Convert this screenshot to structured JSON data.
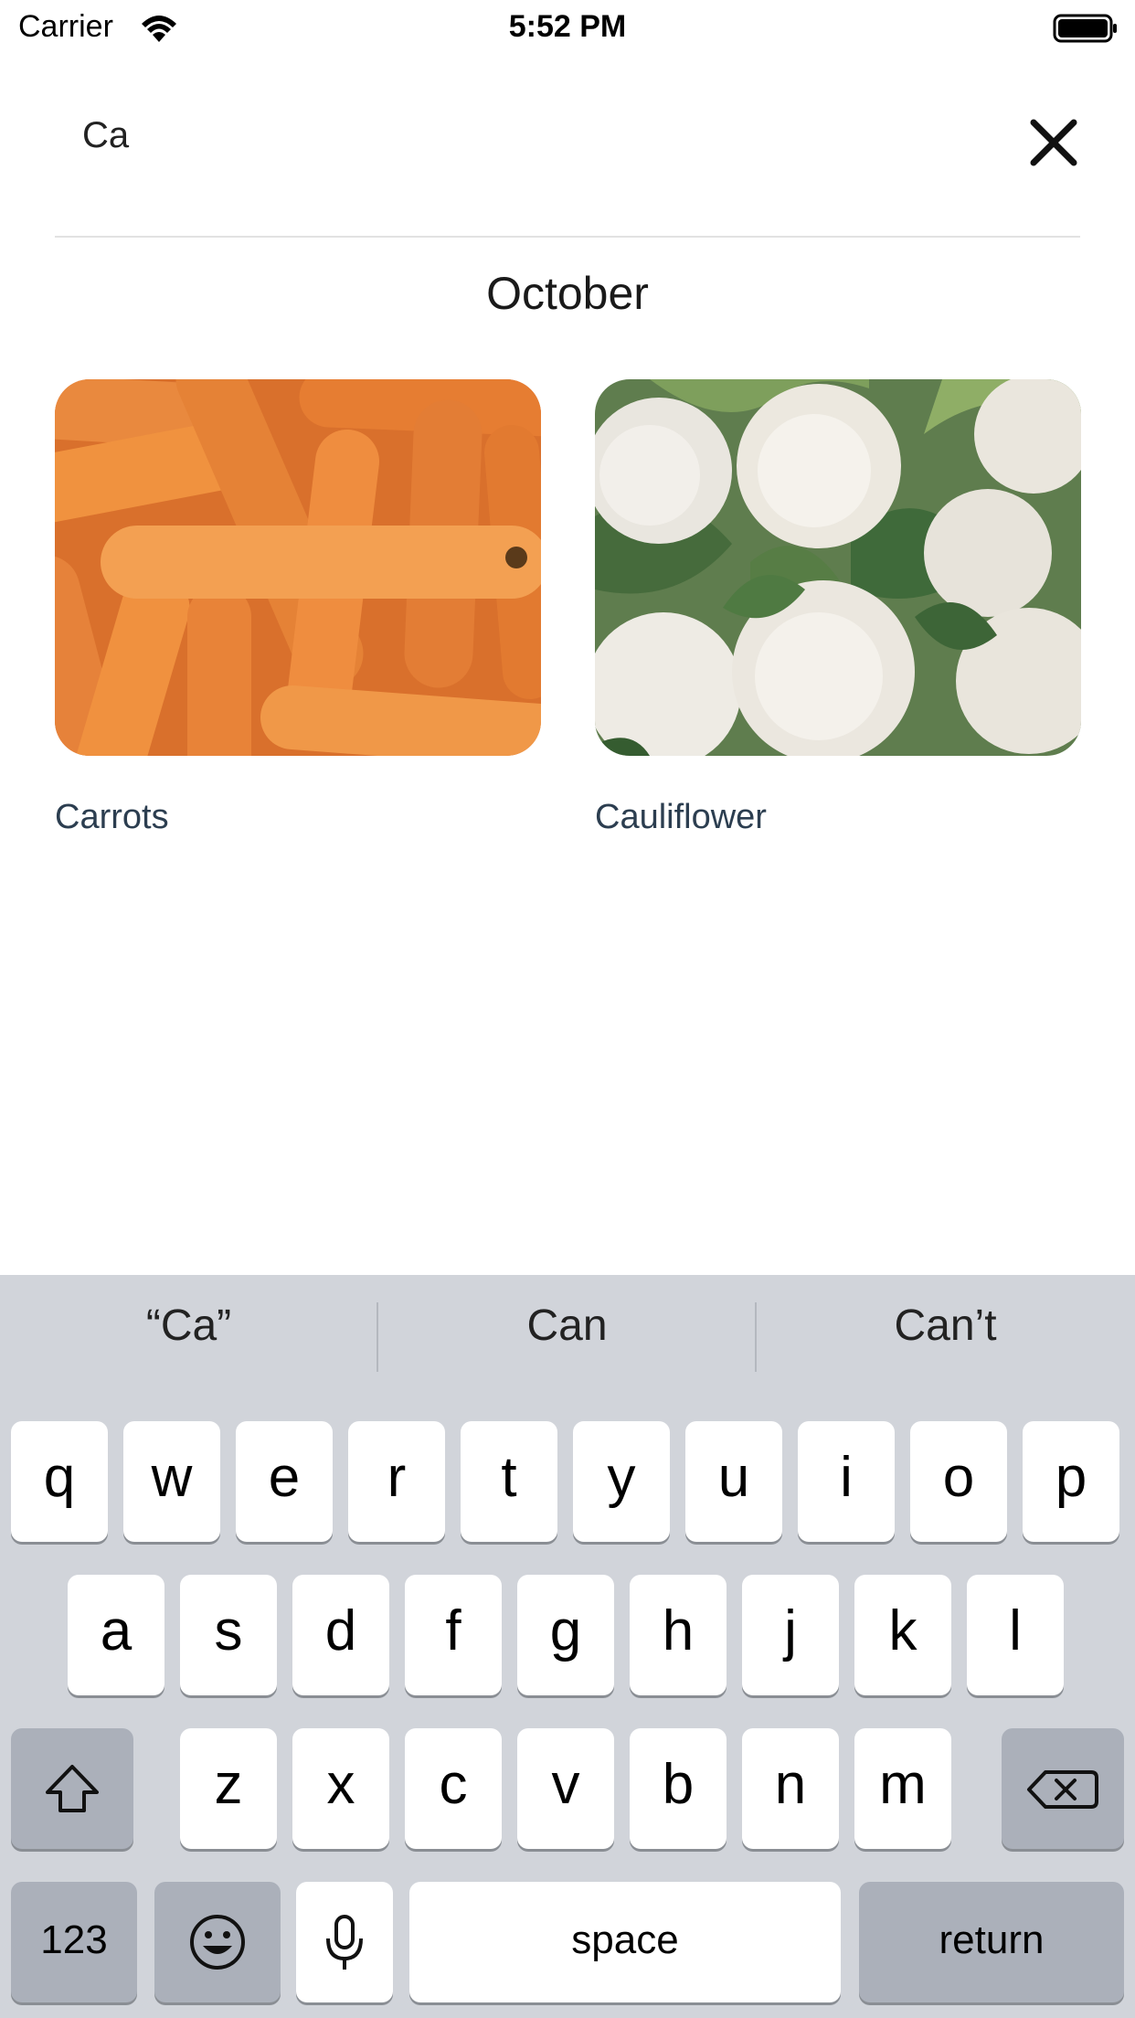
{
  "status_bar": {
    "carrier": "Carrier",
    "time": "5:52 PM",
    "wifi_icon": "wifi-icon",
    "battery_icon": "battery-icon"
  },
  "search": {
    "value": "Ca",
    "close_icon": "close-icon"
  },
  "month": "October",
  "results": [
    {
      "label": "Carrots",
      "image": "carrots-photo"
    },
    {
      "label": "Cauliflower",
      "image": "cauliflower-photo"
    }
  ],
  "keyboard": {
    "suggestions": [
      "“Ca”",
      "Can",
      "Can’t"
    ],
    "row1": [
      "q",
      "w",
      "e",
      "r",
      "t",
      "y",
      "u",
      "i",
      "o",
      "p"
    ],
    "row2": [
      "a",
      "s",
      "d",
      "f",
      "g",
      "h",
      "j",
      "k",
      "l"
    ],
    "row3": [
      "z",
      "x",
      "c",
      "v",
      "b",
      "n",
      "m"
    ],
    "numbers_label": "123",
    "space_label": "space",
    "return_label": "return",
    "shift_icon": "shift-icon",
    "delete_icon": "delete-icon",
    "emoji_icon": "emoji-icon",
    "mic_icon": "microphone-icon"
  }
}
